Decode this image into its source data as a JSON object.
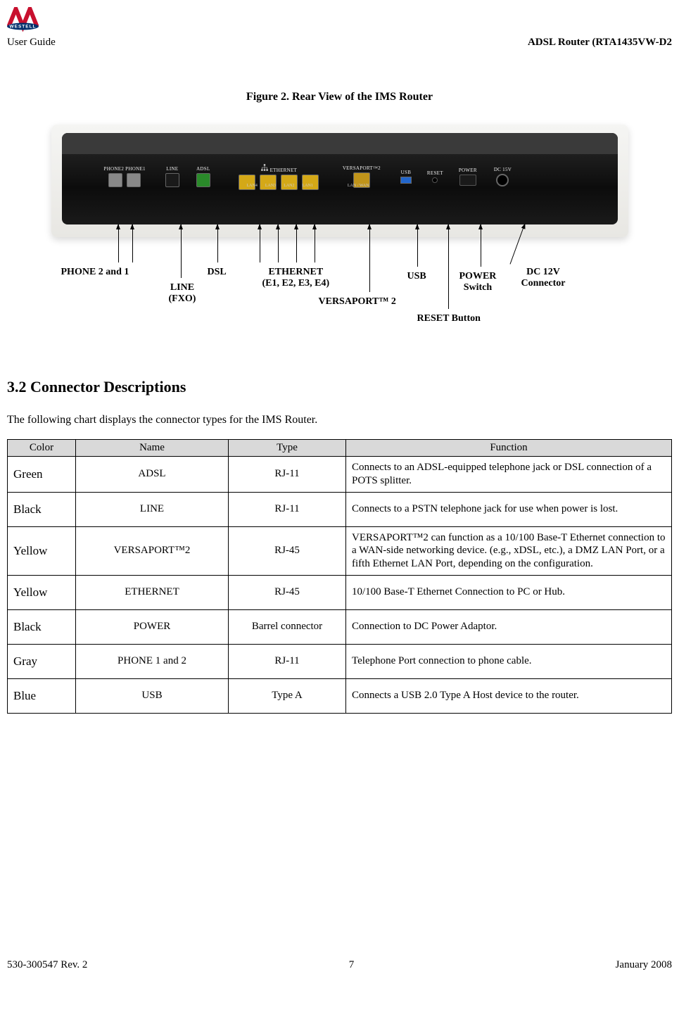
{
  "header": {
    "brand": "WESTELL",
    "left_sub": "User Guide",
    "right": "ADSL Router (RTA1435VW-D2"
  },
  "figure": {
    "caption": "Figure 2. Rear View of the IMS Router",
    "router_labels": {
      "phone": "PHONE2  PHONE1",
      "line": "LINE",
      "adsl": "ADSL",
      "ethernet": "ETHERNET",
      "lan4": "LAN4",
      "lan3": "LAN3",
      "lan2": "LAN2",
      "lan1": "LAN1",
      "versaport": "VERSAPORT™2",
      "lanwan": "LAN / WAN",
      "usb": "USB",
      "reset": "RESET",
      "power": "POWER",
      "dc": "DC 15V"
    },
    "callouts": {
      "phone": "PHONE 2 and 1",
      "line1": "LINE",
      "line2": "(FXO)",
      "dsl": "DSL",
      "eth1": "ETHERNET",
      "eth2": "(E1, E2, E3, E4)",
      "versaport": "VERSAPORT™ 2",
      "usb": "USB",
      "reset": "RESET Button",
      "power1": "POWER",
      "power2": "Switch",
      "dc1": "DC 12V",
      "dc2": "Connector"
    }
  },
  "section": {
    "heading": "3.2 Connector Descriptions",
    "intro": "The following chart displays the connector types for the IMS Router."
  },
  "table": {
    "headers": {
      "c1": "Color",
      "c2": "Name",
      "c3": "Type",
      "c4": "Function"
    },
    "rows": [
      {
        "color": "Green",
        "name": "ADSL",
        "type": "RJ-11",
        "func": "Connects to an ADSL-equipped telephone jack or DSL connection of a POTS splitter."
      },
      {
        "color": "Black",
        "name": "LINE",
        "type": "RJ-11",
        "func": "Connects to a PSTN telephone jack for use when power is lost."
      },
      {
        "color": "Yellow",
        "name": "VERSAPORT™2",
        "type": "RJ-45",
        "func": "VERSAPORT™2 can function as a 10/100 Base-T Ethernet connection to a WAN-side networking device. (e.g., xDSL, etc.), a DMZ LAN Port, or a fifth Ethernet LAN Port, depending on the configuration."
      },
      {
        "color": "Yellow",
        "name": "ETHERNET",
        "type": "RJ-45",
        "func": "10/100 Base-T Ethernet Connection to PC or Hub."
      },
      {
        "color": "Black",
        "name": "POWER",
        "type": "Barrel connector",
        "func": "Connection to DC Power Adaptor."
      },
      {
        "color": "Gray",
        "name": "PHONE 1 and 2",
        "type": "RJ-11",
        "func": "Telephone Port connection to phone cable."
      },
      {
        "color": "Blue",
        "name": "USB",
        "type": "Type A",
        "func": "Connects a USB 2.0 Type A Host device to the router."
      }
    ]
  },
  "footer": {
    "left": "530-300547 Rev. 2",
    "center": "7",
    "right": "January 2008"
  }
}
